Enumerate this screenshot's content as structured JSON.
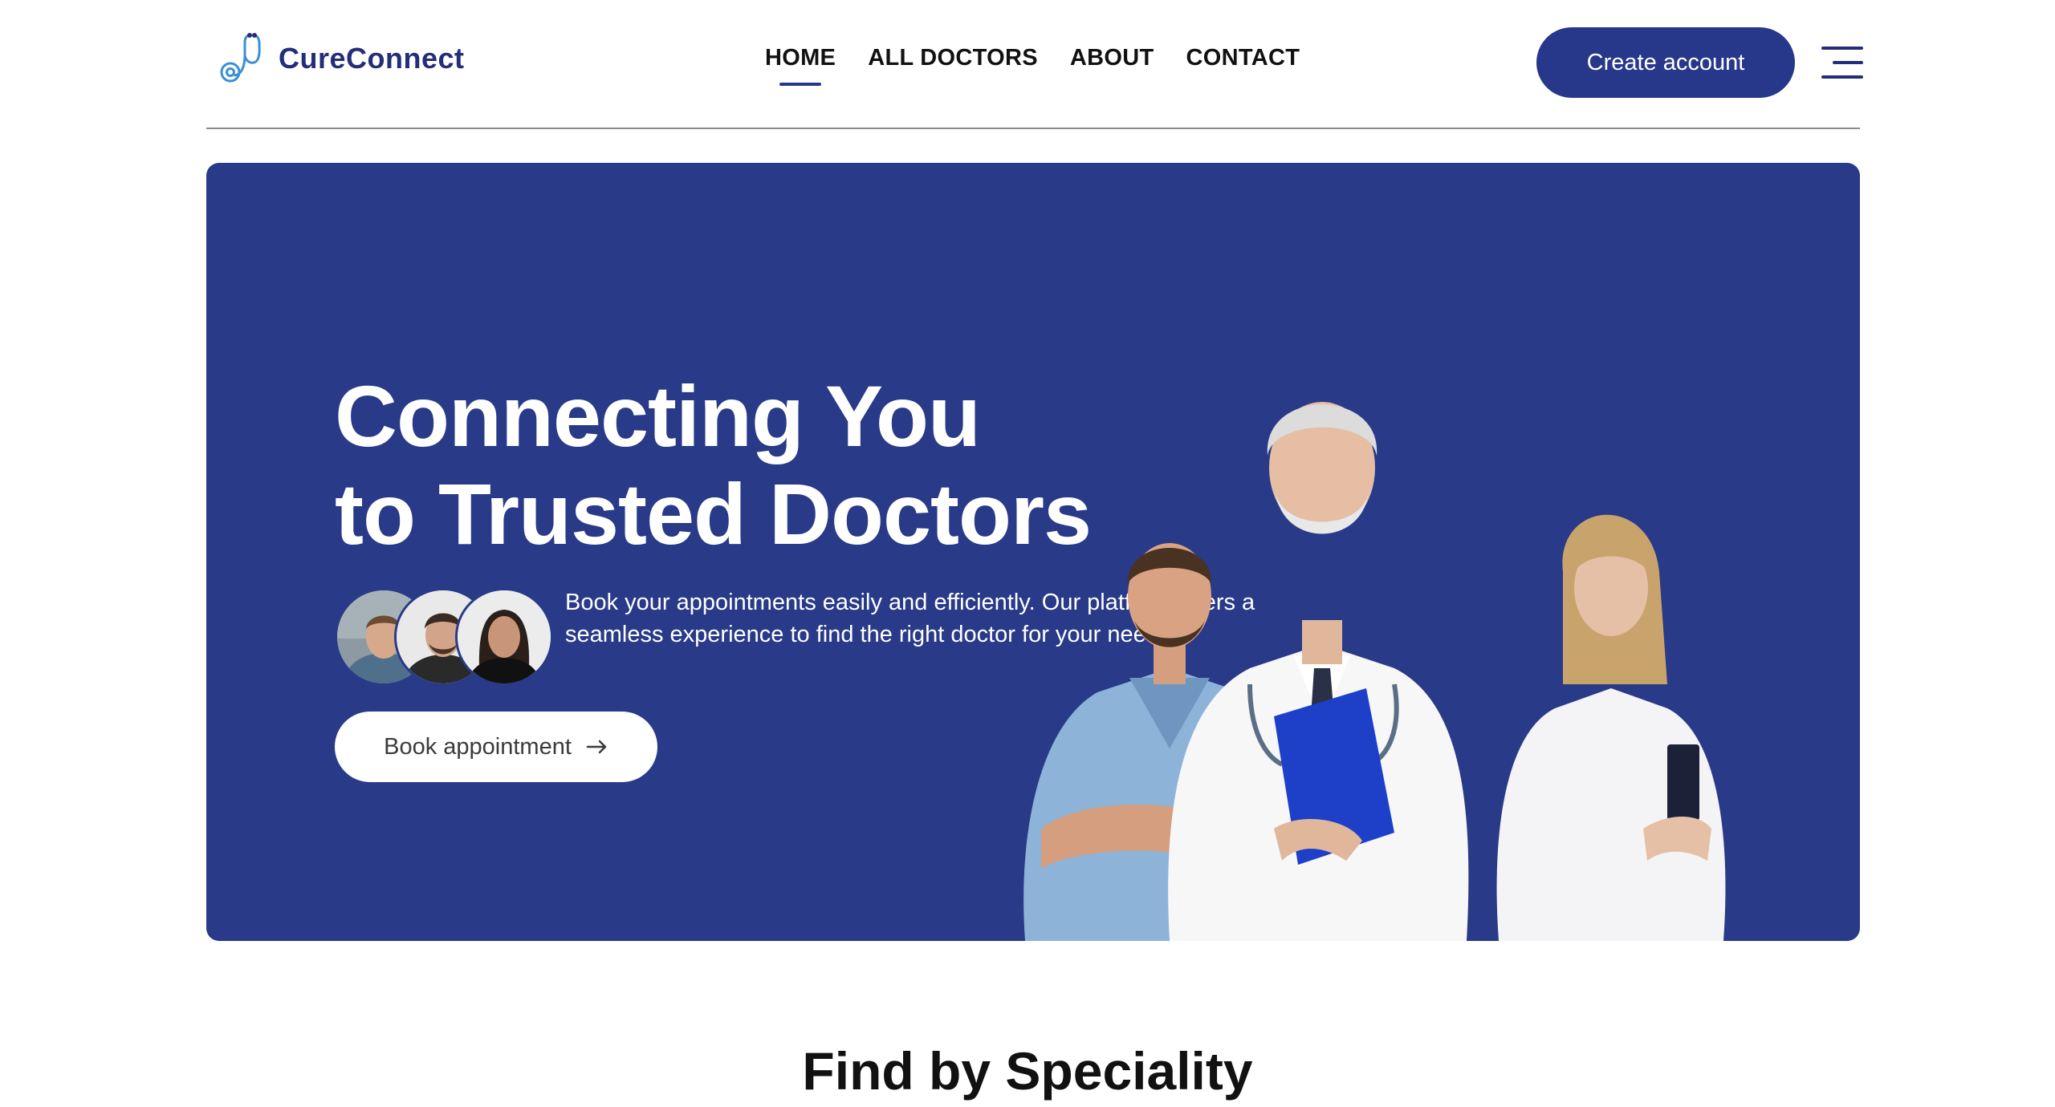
{
  "brand": {
    "name": "CureConnect",
    "logo_icon": "stethoscope-icon",
    "color": "#232d7a"
  },
  "nav": {
    "items": [
      {
        "label": "HOME",
        "active": true
      },
      {
        "label": "ALL DOCTORS",
        "active": false
      },
      {
        "label": "ABOUT",
        "active": false
      },
      {
        "label": "CONTACT",
        "active": false
      }
    ]
  },
  "header": {
    "create_account_label": "Create account",
    "menu_icon": "hamburger-menu-icon"
  },
  "hero": {
    "title_line1": "Connecting You",
    "title_line2": "to Trusted Doctors",
    "description": "Book your appointments easily and efficiently. Our platform offers a seamless experience to find the right doctor for your needs.",
    "cta_label": "Book appointment",
    "cta_icon": "arrow-right-icon",
    "background": "#283a88"
  },
  "section": {
    "title": "Find by Speciality"
  },
  "colors": {
    "primary": "#27388a",
    "text": "#111111",
    "white": "#ffffff"
  }
}
